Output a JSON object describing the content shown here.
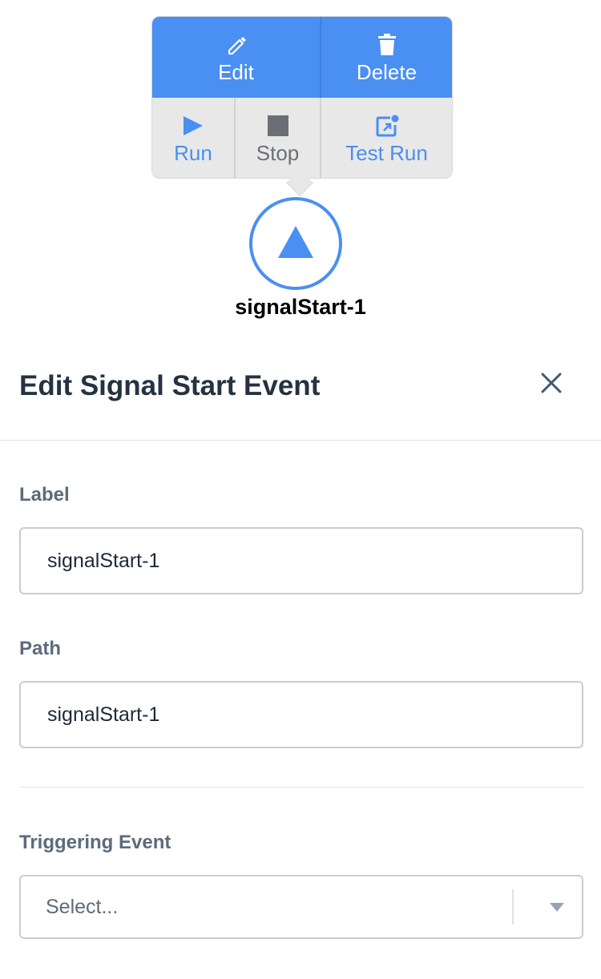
{
  "toolbar": {
    "edit_label": "Edit",
    "delete_label": "Delete",
    "run_label": "Run",
    "stop_label": "Stop",
    "test_run_label": "Test Run"
  },
  "node": {
    "label": "signalStart-1"
  },
  "panel": {
    "title": "Edit Signal Start Event",
    "fields": {
      "label": {
        "label": "Label",
        "value": "signalStart-1"
      },
      "path": {
        "label": "Path",
        "value": "signalStart-1"
      },
      "triggering_event": {
        "label": "Triggering Event",
        "placeholder": "Select..."
      }
    }
  },
  "icons": {
    "edit": "pencil-icon",
    "delete": "trash-icon",
    "run": "play-icon",
    "stop": "stop-icon",
    "test_run": "test-run-icon",
    "node": "signal-triangle-icon",
    "close": "close-icon",
    "dropdown": "chevron-down-icon"
  },
  "colors": {
    "accent": "#4a8ff2",
    "toolbar_bottom": "#e8e8e8",
    "title": "#253242",
    "field_label": "#5b6b7c"
  }
}
